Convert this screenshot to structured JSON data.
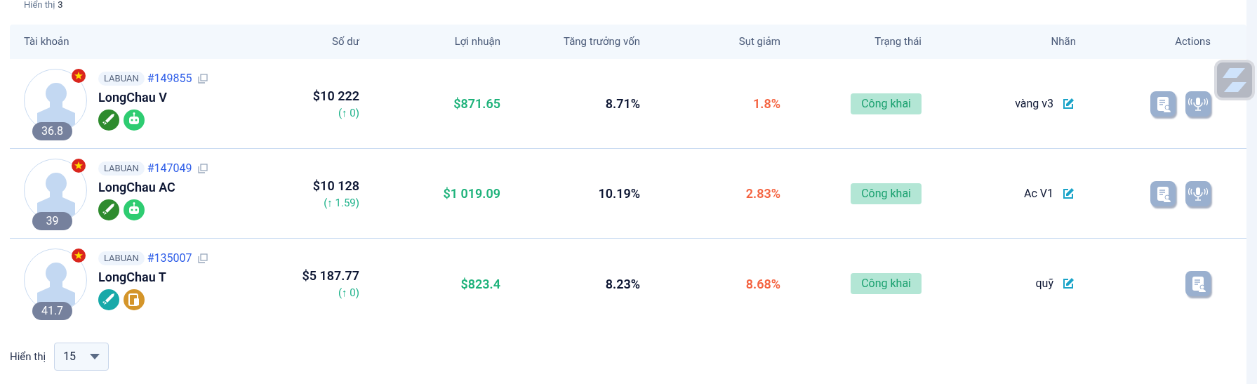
{
  "summary": {
    "label": "Hiển thị",
    "count": "3"
  },
  "table": {
    "columns": [
      "Tài khoản",
      "Số dư",
      "Lợi nhuận",
      "Tăng trưởng vốn",
      "Sụt giảm",
      "Trạng thái",
      "Nhãn",
      "Actions"
    ],
    "rows": [
      {
        "server": "LABUAN",
        "id": "#149855",
        "name": "LongChau V",
        "score": "36.8",
        "apps": [
          {
            "kind": "rocket",
            "color": "#2e8b2e"
          },
          {
            "kind": "robot",
            "color": "#2ecc71"
          }
        ],
        "balance": "$10 222",
        "change": "(↑ 0)",
        "profit": "$871.65",
        "growth": "8.71%",
        "drawdown": "1.8%",
        "status": "Công khai",
        "label": "vàng v3",
        "actions": [
          {
            "kind": "report"
          },
          {
            "kind": "broadcast"
          }
        ]
      },
      {
        "server": "LABUAN",
        "id": "#147049",
        "name": "LongChau AC",
        "score": "39",
        "apps": [
          {
            "kind": "rocket",
            "color": "#2e8b2e"
          },
          {
            "kind": "robot",
            "color": "#2ecc71"
          }
        ],
        "balance": "$10 128",
        "change": "(↑ 1.59)",
        "profit": "$1 019.09",
        "growth": "10.19%",
        "drawdown": "2.83%",
        "status": "Công khai",
        "label": "Ac V1",
        "actions": [
          {
            "kind": "report"
          },
          {
            "kind": "broadcast"
          }
        ]
      },
      {
        "server": "LABUAN",
        "id": "#135007",
        "name": "LongChau T",
        "score": "41.7",
        "apps": [
          {
            "kind": "rocket",
            "color": "#17a9a9"
          },
          {
            "kind": "device",
            "color": "#d4952a"
          }
        ],
        "balance": "$5 187.77",
        "change": "(↑ 0)",
        "profit": "$823.4",
        "growth": "8.23%",
        "drawdown": "8.68%",
        "status": "Công khai",
        "label": "quỹ",
        "actions": [
          {
            "kind": "report"
          }
        ]
      }
    ]
  },
  "page_size": {
    "label": "Hiển thị",
    "value": "15"
  }
}
